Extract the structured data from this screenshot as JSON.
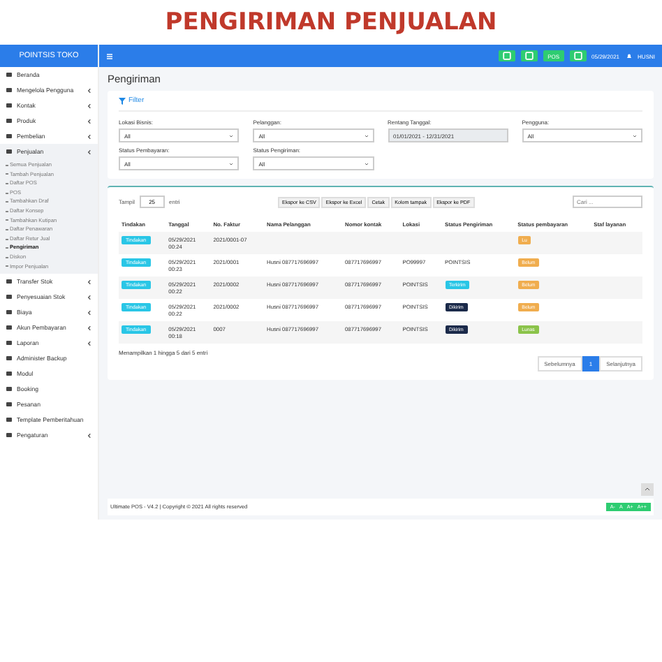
{
  "title": "PENGIRIMAN PENJUALAN",
  "topbar": {
    "brand": "POINTSIS TOKO",
    "actions": [
      {
        "kind": "icon"
      },
      {
        "kind": "icon"
      },
      {
        "kind": "pos",
        "label": "POS"
      },
      {
        "kind": "icon"
      }
    ],
    "date": "05/29/2021",
    "user": "HUSNI"
  },
  "sidebar": {
    "items": [
      {
        "label": "Beranda",
        "expandable": false,
        "selected": false
      },
      {
        "label": "Mengelola Pengguna",
        "expandable": true,
        "selected": false
      },
      {
        "label": "Kontak",
        "expandable": true,
        "selected": false
      },
      {
        "label": "Produk",
        "expandable": true,
        "selected": false
      },
      {
        "label": "Pembelian",
        "expandable": true,
        "selected": false
      },
      {
        "label": "Penjualan",
        "expandable": true,
        "selected": true,
        "children": [
          {
            "label": "Semua Penjualan",
            "selected": false
          },
          {
            "label": "Tambah Penjualan",
            "selected": false
          },
          {
            "label": "Daftar POS",
            "selected": false
          },
          {
            "label": "POS",
            "selected": false
          },
          {
            "label": "Tambahkan Draf",
            "selected": false
          },
          {
            "label": "Daftar Konsep",
            "selected": false
          },
          {
            "label": "Tambahkan Kutipan",
            "selected": false
          },
          {
            "label": "Daftar Penawaran",
            "selected": false
          },
          {
            "label": "Daftar Retur Jual",
            "selected": false
          },
          {
            "label": "Pengiriman",
            "selected": true
          },
          {
            "label": "Diskon",
            "selected": false
          },
          {
            "label": "Impor Penjualan",
            "selected": false
          }
        ]
      },
      {
        "label": "Transfer Stok",
        "expandable": true,
        "selected": false
      },
      {
        "label": "Penyesuaian Stok",
        "expandable": true,
        "selected": false
      },
      {
        "label": "Biaya",
        "expandable": true,
        "selected": false
      },
      {
        "label": "Akun Pembayaran",
        "expandable": true,
        "selected": false
      },
      {
        "label": "Laporan",
        "expandable": true,
        "selected": false
      },
      {
        "label": "Administer Backup",
        "expandable": false,
        "selected": false
      },
      {
        "label": "Modul",
        "expandable": false,
        "selected": false
      },
      {
        "label": "Booking",
        "expandable": false,
        "selected": false
      },
      {
        "label": "Pesanan",
        "expandable": false,
        "selected": false
      },
      {
        "label": "Template Pemberitahuan",
        "expandable": false,
        "selected": false
      },
      {
        "label": "Pengaturan",
        "expandable": true,
        "selected": false
      }
    ]
  },
  "page_title": "Pengiriman",
  "filter": {
    "title": "Filter",
    "fields": [
      {
        "label": "Lokasi Bisnis:",
        "value": "All",
        "kind": "select"
      },
      {
        "label": "Pelanggan:",
        "value": "All",
        "kind": "select"
      },
      {
        "label": "Rentang Tanggal:",
        "value": "01/01/2021 - 12/31/2021",
        "kind": "range"
      },
      {
        "label": "Pengguna:",
        "value": "All",
        "kind": "select"
      },
      {
        "label": "Status Pembayaran:",
        "value": "All",
        "kind": "select"
      },
      {
        "label": "Status Pengiriman:",
        "value": "All",
        "kind": "select"
      }
    ]
  },
  "tools": {
    "show_label": "Tampil",
    "page_size": "25",
    "entries_label": "entri",
    "exports": [
      "Ekspor ke CSV",
      "Ekspor ke Excel",
      "Cetak",
      "Kolom tampak",
      "Ekspor ke PDF"
    ],
    "search_placeholder": "Cari ..."
  },
  "table": {
    "columns": [
      "Tindakan",
      "Tanggal",
      "No. Faktur",
      "Nama Pelanggan",
      "Nomor kontak",
      "Lokasi",
      "Status Pengiriman",
      "Status pembayaran",
      "Staf layanan"
    ],
    "rows": [
      {
        "action": "Tindakan",
        "date": "05/29/2021",
        "time": "00:24",
        "invoice": "2021/0001-07",
        "customer": "",
        "contact": "",
        "location": "",
        "shipping": null,
        "payment": {
          "text": "Lu",
          "kind": "due"
        }
      },
      {
        "action": "Tindakan",
        "date": "05/29/2021",
        "time": "00:23",
        "invoice": "2021/0001",
        "customer": "Husni 087717696997",
        "contact": "087717696997",
        "location": "PO99997",
        "shipping": {
          "text": "POINTSIS",
          "kind": "plain"
        },
        "payment": {
          "text": "Belum",
          "kind": "due"
        }
      },
      {
        "action": "Tindakan",
        "date": "05/29/2021",
        "time": "00:22",
        "invoice": "2021/0002",
        "customer": "Husni 087717696997",
        "contact": "087717696997",
        "location": "POINTSIS",
        "shipping": {
          "text": "Terkirim",
          "kind": "delivered"
        },
        "payment": {
          "text": "Belum",
          "kind": "due"
        }
      },
      {
        "action": "Tindakan",
        "date": "05/29/2021",
        "time": "00:22",
        "invoice": "2021/0002",
        "customer": "Husni 087717696997",
        "contact": "087717696997",
        "location": "POINTSIS",
        "shipping": {
          "text": "Dikirim",
          "kind": "shipped"
        },
        "payment": {
          "text": "Belum",
          "kind": "due"
        }
      },
      {
        "action": "Tindakan",
        "date": "05/29/2021",
        "time": "00:18",
        "invoice": "0007",
        "customer": "Husni 087717696997",
        "contact": "087717696997",
        "location": "POINTSIS",
        "shipping": {
          "text": "Dikirim",
          "kind": "shipped"
        },
        "payment": {
          "text": "Lunas",
          "kind": "paid"
        }
      }
    ]
  },
  "info": "Menampilkan 1 hingga 5 dari 5 entri",
  "pagination": {
    "prev": "Sebelumnya",
    "pages": [
      {
        "label": "1",
        "selected": true
      }
    ],
    "next": "Selanjutnya"
  },
  "footer": "Ultimate POS - V4.2 | Copyright © 2021 All rights reserved",
  "font_buttons": [
    "A-",
    "A",
    "A+",
    "A++"
  ]
}
